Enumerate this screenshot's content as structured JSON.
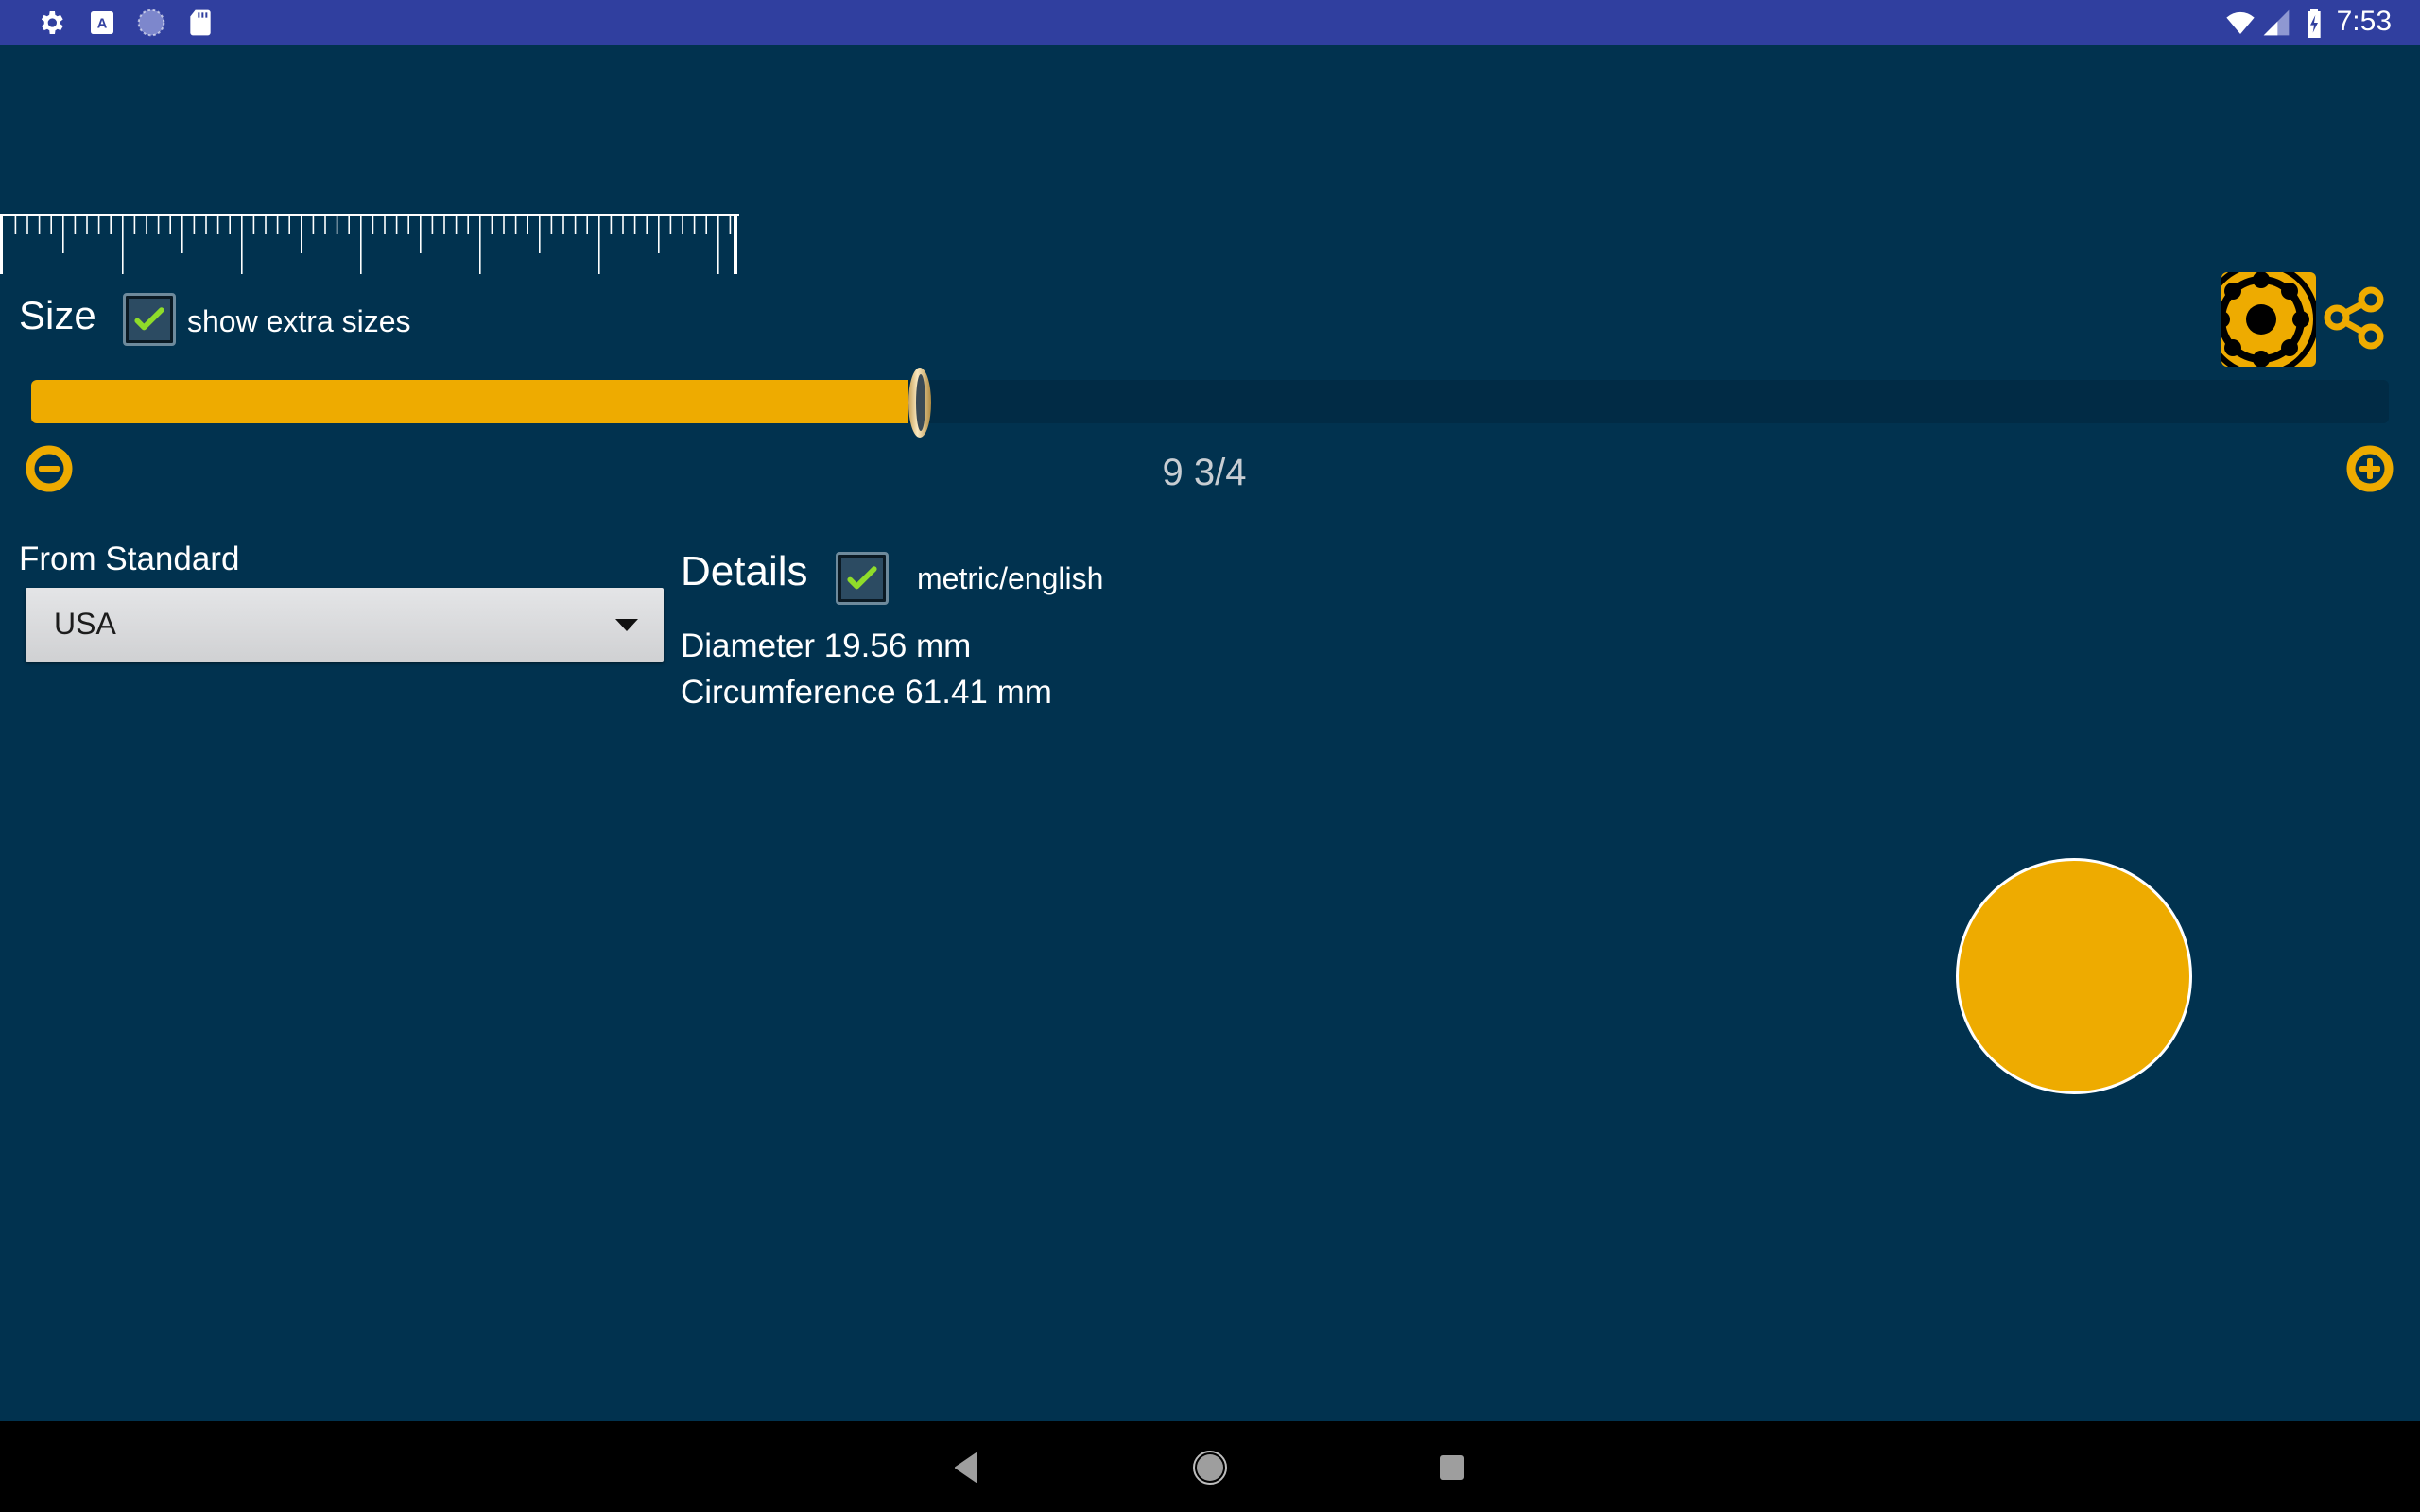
{
  "status_bar": {
    "left_icons": [
      "settings-icon",
      "text-input-icon",
      "loading-circle-icon",
      "sd-card-icon"
    ],
    "right_icons": [
      "wifi-icon",
      "cell-signal-icon",
      "battery-charging-icon"
    ],
    "time": "7:53"
  },
  "ruler": {
    "unit": "mm",
    "length_mm": 61,
    "major_every_mm": 10,
    "medium_every_mm": 5
  },
  "size_section": {
    "title": "Size",
    "show_extra_sizes_label": "show extra sizes",
    "show_extra_sizes_checked": true
  },
  "slider": {
    "value_label": "9 3/4",
    "position_fraction": 0.377,
    "minus_icon": "minus-circle-icon",
    "plus_icon": "plus-circle-icon",
    "thumb_icon": "ring-icon"
  },
  "toolbar": {
    "settings_icon": "gear-icon",
    "share_icon": "share-icon"
  },
  "standard": {
    "label": "From Standard",
    "selected": "USA"
  },
  "details": {
    "title": "Details",
    "metric_english_label": "metric/english",
    "metric_english_checked": true,
    "diameter": "Diameter 19.56 mm",
    "circumference": "Circumference 61.41 mm"
  },
  "colors": {
    "background": "#01324f",
    "accent": "#eeab00",
    "status_bar": "#303f9f",
    "nav_bar": "#000000",
    "check": "#8fdc2a"
  },
  "nav_bar": {
    "buttons": [
      "back-icon",
      "home-icon",
      "recents-icon"
    ]
  }
}
